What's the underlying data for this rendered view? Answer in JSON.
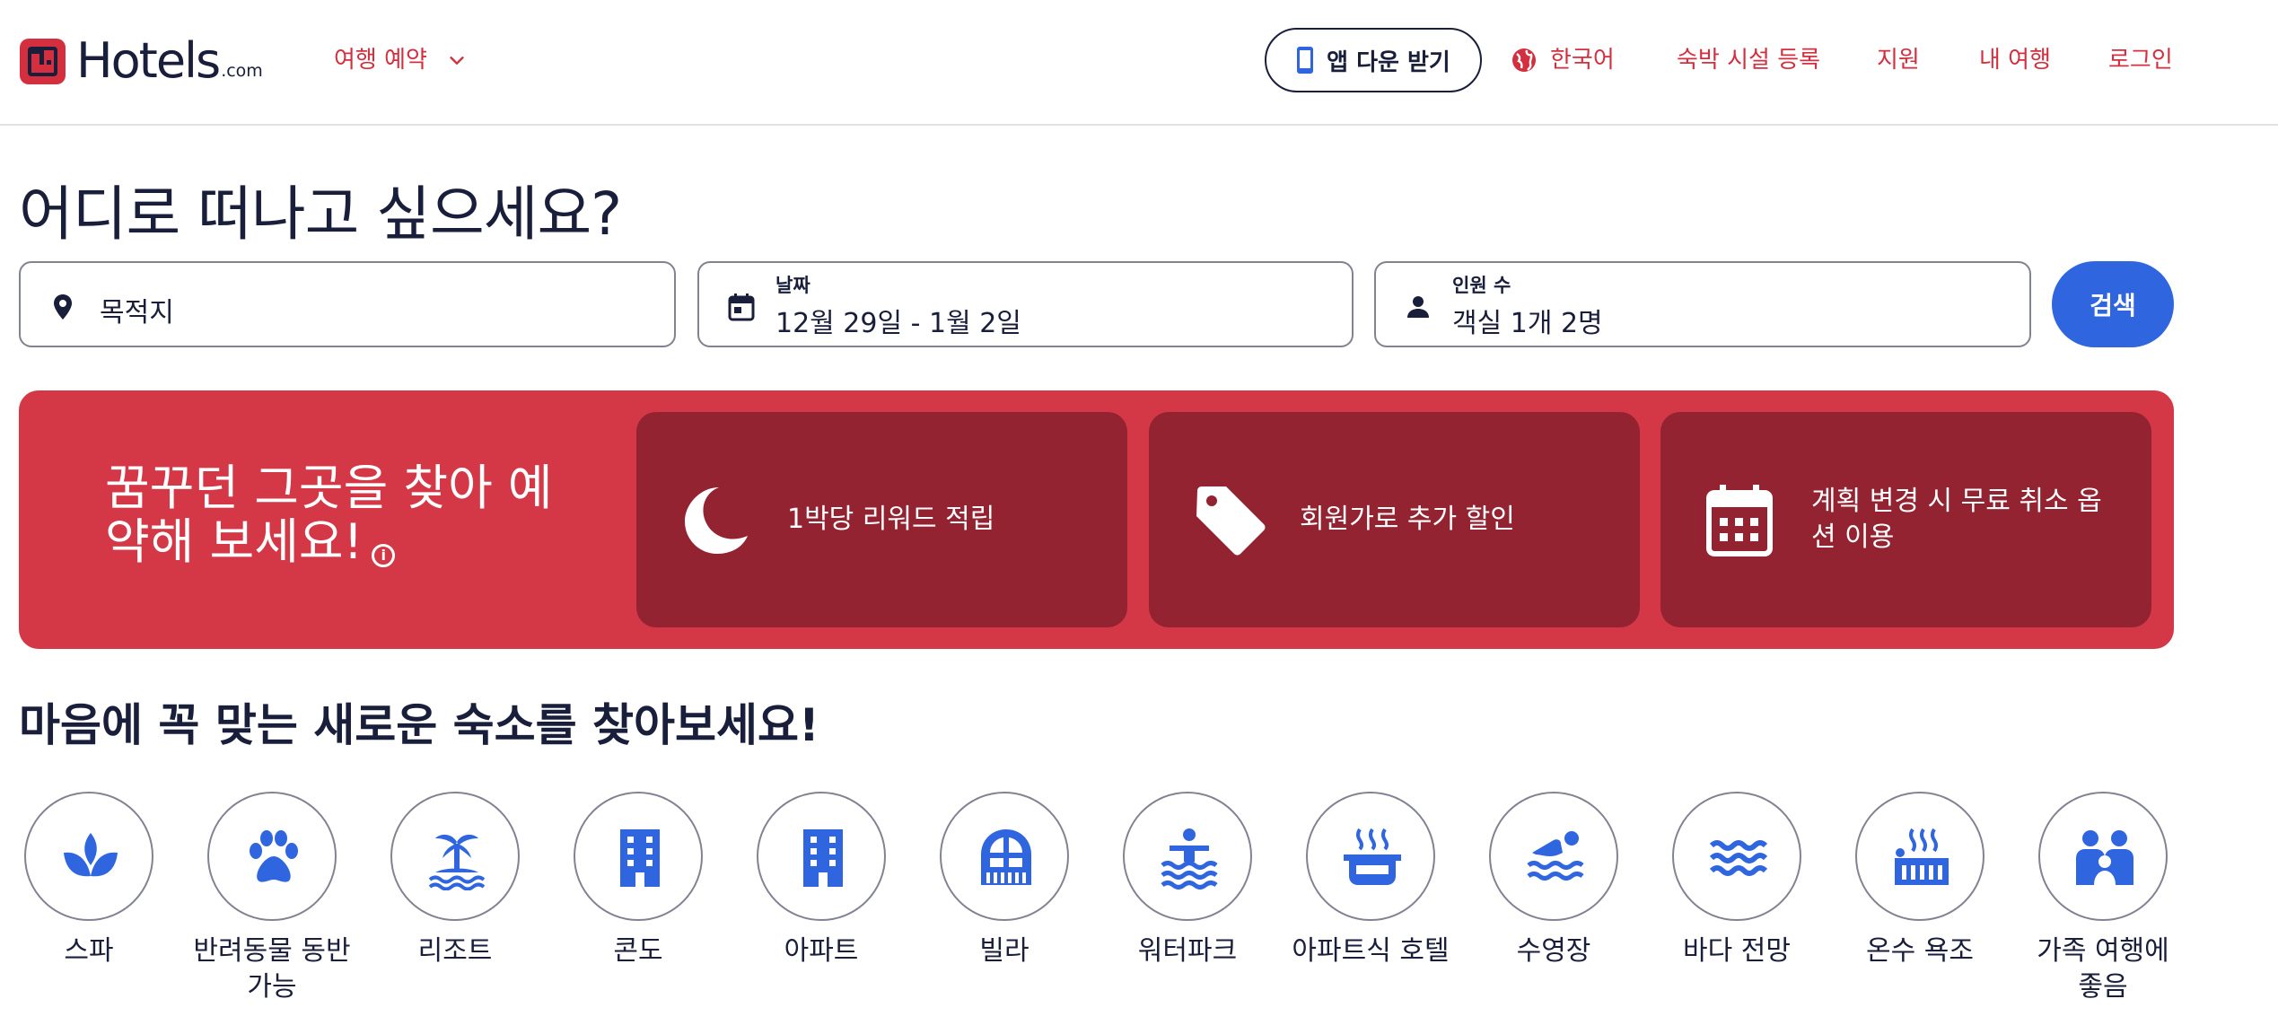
{
  "header": {
    "logo_text": "Hotels",
    "logo_suffix": ".com",
    "trip_menu_label": "여행 예약",
    "app_button_label": "앱 다운 받기",
    "language_label": "한국어",
    "list_property_label": "숙박 시설 등록",
    "support_label": "지원",
    "my_trips_label": "내 여행",
    "login_label": "로그인"
  },
  "search": {
    "headline": "어디로 떠나고 싶으세요?",
    "destination_placeholder": "목적지",
    "date_label": "날짜",
    "date_value": "12월 29일 - 1월 2일",
    "guests_label": "인원 수",
    "guests_value": "객실 1개 2명",
    "search_button_label": "검색"
  },
  "banner": {
    "title": "꿈꾸던 그곳을 찾아 예약해 보세요!",
    "info_icon": "i",
    "cards": [
      {
        "icon": "moon-icon",
        "text": "1박당 리워드 적립"
      },
      {
        "icon": "tag-icon",
        "text": "회원가로 추가 할인"
      },
      {
        "icon": "calendar-icon",
        "text": "계획 변경 시 무료 취소 옵션 이용"
      }
    ]
  },
  "property_types": {
    "headline": "마음에 꼭 맞는 새로운 숙소를 찾아보세요!",
    "items": [
      {
        "icon": "spa-icon",
        "label": "스파"
      },
      {
        "icon": "paw-icon",
        "label": "반려동물 동반 가능"
      },
      {
        "icon": "palm-tree-icon",
        "label": "리조트"
      },
      {
        "icon": "building-icon",
        "label": "콘도"
      },
      {
        "icon": "building-icon",
        "label": "아파트"
      },
      {
        "icon": "villa-icon",
        "label": "빌라"
      },
      {
        "icon": "water-park-icon",
        "label": "워터파크"
      },
      {
        "icon": "kitchen-pot-icon",
        "label": "아파트식 호텔"
      },
      {
        "icon": "swimming-icon",
        "label": "수영장"
      },
      {
        "icon": "waves-icon",
        "label": "바다 전망"
      },
      {
        "icon": "hot-tub-icon",
        "label": "온수 욕조"
      },
      {
        "icon": "family-icon",
        "label": "가족 여행에 좋음"
      }
    ]
  },
  "colors": {
    "brand_red": "#d32f3f",
    "banner_red": "#d43846",
    "card_dark_red": "#942332",
    "primary_blue": "#2f66df",
    "text_navy": "#191e3b"
  }
}
